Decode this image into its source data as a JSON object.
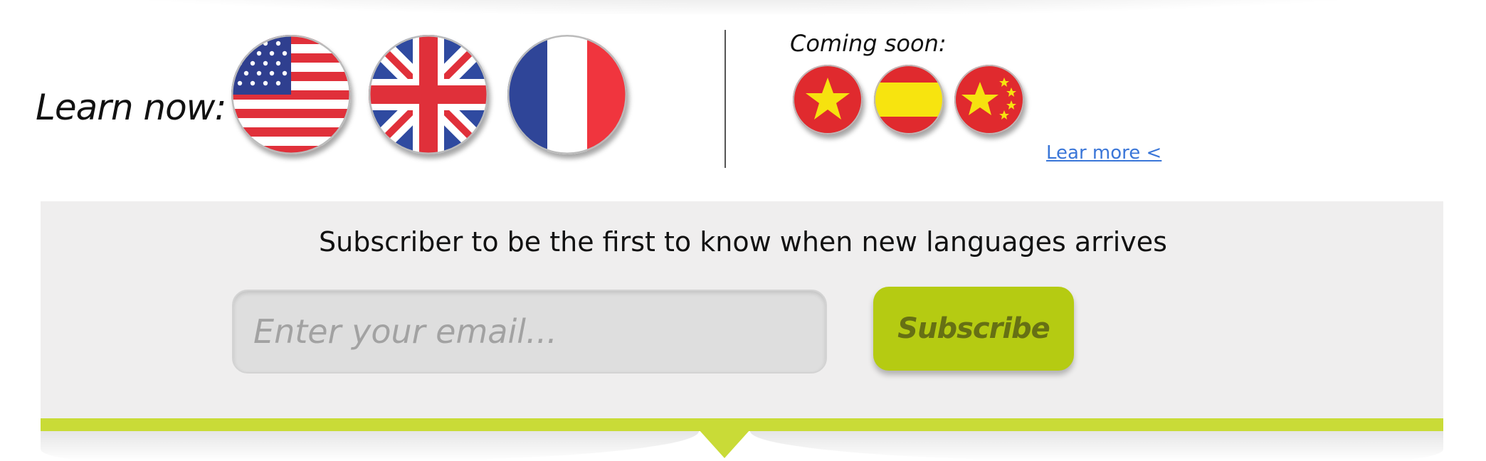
{
  "learn_now": {
    "label": "Learn now:",
    "flags": [
      {
        "name": "united-states-flag-icon"
      },
      {
        "name": "united-kingdom-flag-icon"
      },
      {
        "name": "france-flag-icon"
      }
    ]
  },
  "coming_soon": {
    "label": "Coming soon:",
    "flags": [
      {
        "name": "vietnam-flag-icon"
      },
      {
        "name": "spain-flag-icon"
      },
      {
        "name": "china-flag-icon"
      }
    ],
    "learn_more_link": "Lear more <"
  },
  "subscribe": {
    "heading": "Subscriber to be the first to know when new languages arrives",
    "email_placeholder": "Enter your email...",
    "email_value": "",
    "button_label": "Subscribe"
  },
  "colors": {
    "accent": "#c9db37",
    "button": "#b5cb12",
    "button_text": "#667014",
    "link": "#3a76d8",
    "panel": "#efeeee"
  }
}
